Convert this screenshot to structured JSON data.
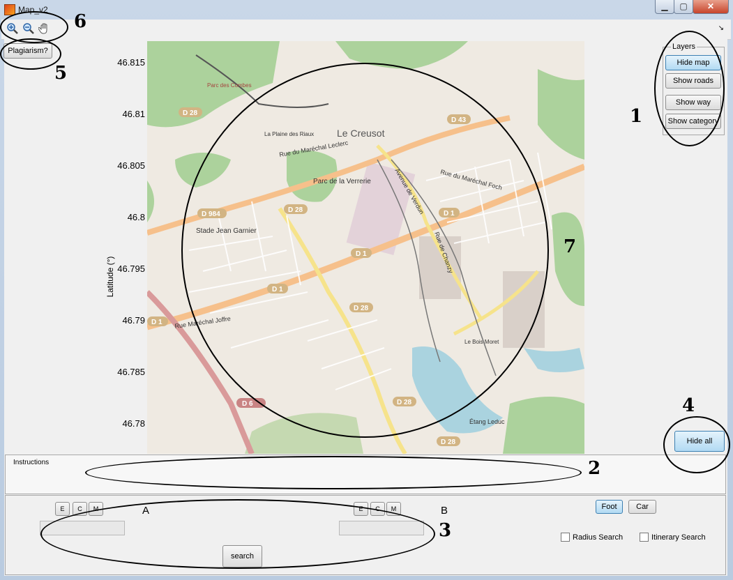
{
  "window": {
    "title": "Map_v2",
    "minimize": "▁",
    "maximize": "▢",
    "close": "✕"
  },
  "toolbar": {
    "zoom_in": "zoom-in-icon",
    "zoom_out": "zoom-out-icon",
    "pan": "pan-hand-icon",
    "corner": "↘"
  },
  "plagiarism_label": "Plagiarism?",
  "axis": {
    "ylabel": "Latitude (°)",
    "yticks": [
      "46.815",
      "46.81",
      "46.805",
      "46.8",
      "46.795",
      "46.79",
      "46.785",
      "46.78"
    ]
  },
  "map": {
    "city": "Le Creusot",
    "labels": {
      "parc_combes": "Parc des Combes",
      "plaine_riaux": "La Plaine des Riaux",
      "rue_leclerc": "Rue du Maréchal Leclerc",
      "parc_verrerie": "Parc de la Verrerie",
      "stade": "Stade Jean Garnier",
      "verdun": "Avenue de Verdun",
      "foch": "Rue du Maréchal Foch",
      "chanzy": "Rue de Chanzy",
      "joffre": "Rue Maréchal Joffre",
      "bois_moret": "Le Bois Moret",
      "etang": "Étang Leduc"
    },
    "roads": {
      "d28": "D 28",
      "d43": "D 43",
      "d984": "D 984",
      "d1": "D 1",
      "d6": "D 6"
    }
  },
  "layers": {
    "title": "Layers",
    "hide_map": "Hide map",
    "show_roads": "Show roads",
    "show_way": "Show way",
    "show_category": "Show category"
  },
  "hide_all": "Hide all",
  "instructions": {
    "title": "Instructions"
  },
  "search": {
    "point_a": "A",
    "point_b": "B",
    "e": "E",
    "c": "C",
    "m": "M",
    "search_button": "search",
    "foot": "Foot",
    "car": "Car",
    "radius_search": "Radius Search",
    "itinerary_search": "Itinerary Search"
  },
  "annotations": {
    "n1": "1",
    "n2": "2",
    "n3": "3",
    "n4": "4",
    "n5": "5",
    "n6": "6",
    "n7": "7"
  }
}
